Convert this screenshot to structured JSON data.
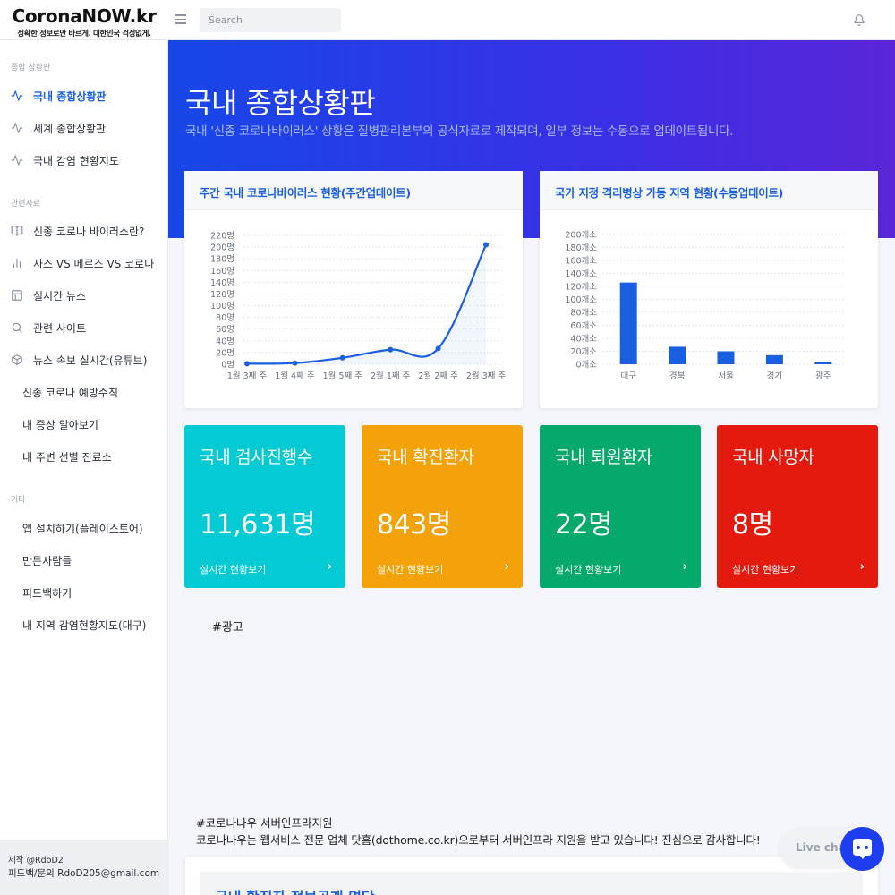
{
  "brand": {
    "title": "CoronaNOW.kr",
    "subtitle": "정확한 정보로만 바르게. 대한민국 걱정없게."
  },
  "search": {
    "placeholder": "Search"
  },
  "sidebar": {
    "section_overview": "종합 상황판",
    "nav": [
      {
        "label": "국내 종합상황판",
        "icon": "activity-icon",
        "active": true
      },
      {
        "label": "세계 종합상황판",
        "icon": "activity-icon"
      },
      {
        "label": "국내 감염 현황지도",
        "icon": "activity-icon"
      }
    ],
    "section_resources": "관련자료",
    "resources": [
      {
        "label": "신종 코로나 바이러스란?",
        "icon": "book-icon"
      },
      {
        "label": "사스 VS 메르스 VS 코로나",
        "icon": "bar-chart-icon"
      },
      {
        "label": "실시간 뉴스",
        "icon": "layout-icon"
      },
      {
        "label": "관련 사이트",
        "icon": "search-icon"
      },
      {
        "label": "뉴스 속보 실시간(유튜브)",
        "icon": "box-icon"
      },
      {
        "label": "신종 코로나 예방수칙"
      },
      {
        "label": "내 증상 알아보기"
      },
      {
        "label": "내 주변 선별 진료소"
      }
    ],
    "section_etc": "기타",
    "etc": [
      {
        "label": "앱 설치하기(플레이스토어)"
      },
      {
        "label": "만든사람들"
      },
      {
        "label": "피드백하기"
      },
      {
        "label": "내 지역 감염현황지도(대구)"
      }
    ],
    "footer_maker": "제작 @RdoD2",
    "footer_contact": "피드백/문의 RdoD205@gmail.com"
  },
  "hero": {
    "title": "국내 종합상황판",
    "subtitle": "국내 '신종 코로나바이러스' 상황은 질병관리본부의 공식자료로 제작되며, 일부 정보는 수동으로 업데이트됩니다."
  },
  "chart_data": [
    {
      "type": "line",
      "title": "주간 국내 코로나바이러스 현황(주간업데이트)",
      "categories": [
        "1월 3째 주",
        "1월 4째 주",
        "1월 5째 주",
        "2월 1째 주",
        "2월 2째 주",
        "2월 3째 주"
      ],
      "series": [
        {
          "values": [
            1,
            2,
            11,
            25,
            27,
            204
          ]
        }
      ],
      "yticks": [
        "0명",
        "20명",
        "40명",
        "60명",
        "80명",
        "100명",
        "120명",
        "140명",
        "160명",
        "180명",
        "200명",
        "220명"
      ],
      "ylim": [
        0,
        220
      ],
      "grid": true,
      "color": "#1a5fe0"
    },
    {
      "type": "bar",
      "title": "국가 지정 격리병상 가동 지역 현황(수동업데이트)",
      "categories": [
        "대구",
        "경북",
        "서울",
        "경기",
        "광주"
      ],
      "values": [
        126,
        27,
        20,
        14,
        4
      ],
      "yticks": [
        "0개소",
        "20개소",
        "40개소",
        "60개소",
        "80개소",
        "100개소",
        "120개소",
        "140개소",
        "160개소",
        "180개소",
        "200개소"
      ],
      "ylim": [
        0,
        200
      ],
      "grid": true,
      "color": "#1a5fe0"
    }
  ],
  "stats": [
    {
      "title": "국내 검사진행수",
      "value": "11,631명",
      "link": "실시간 현황보기",
      "arrow": "›",
      "color": "#04cad4"
    },
    {
      "title": "국내 확진환자",
      "value": "843명",
      "link": "실시간 현황보기",
      "arrow": "›",
      "color": "#f4a20a"
    },
    {
      "title": "국내 퇴원환자",
      "value": "22명",
      "link": "실시간 현황보기",
      "arrow": "›",
      "color": "#04a96b"
    },
    {
      "title": "국내 사망자",
      "value": "8명",
      "link": "실시간 현황보기",
      "arrow": "›",
      "color": "#e41a0f"
    }
  ],
  "ad_tag": "#광고",
  "sponsor": {
    "line1": "#코로나나우 서버인프라지원",
    "line2": "코로나나우는 웹서비스 전문 업체 닷홈(dothome.co.kr)으로부터 서버인프라 지원을 받고 있습니다! 진심으로 감사합니다!"
  },
  "bottom_card_title": "국내 확진자 정보공개 명단",
  "live_chat": "Live chat"
}
